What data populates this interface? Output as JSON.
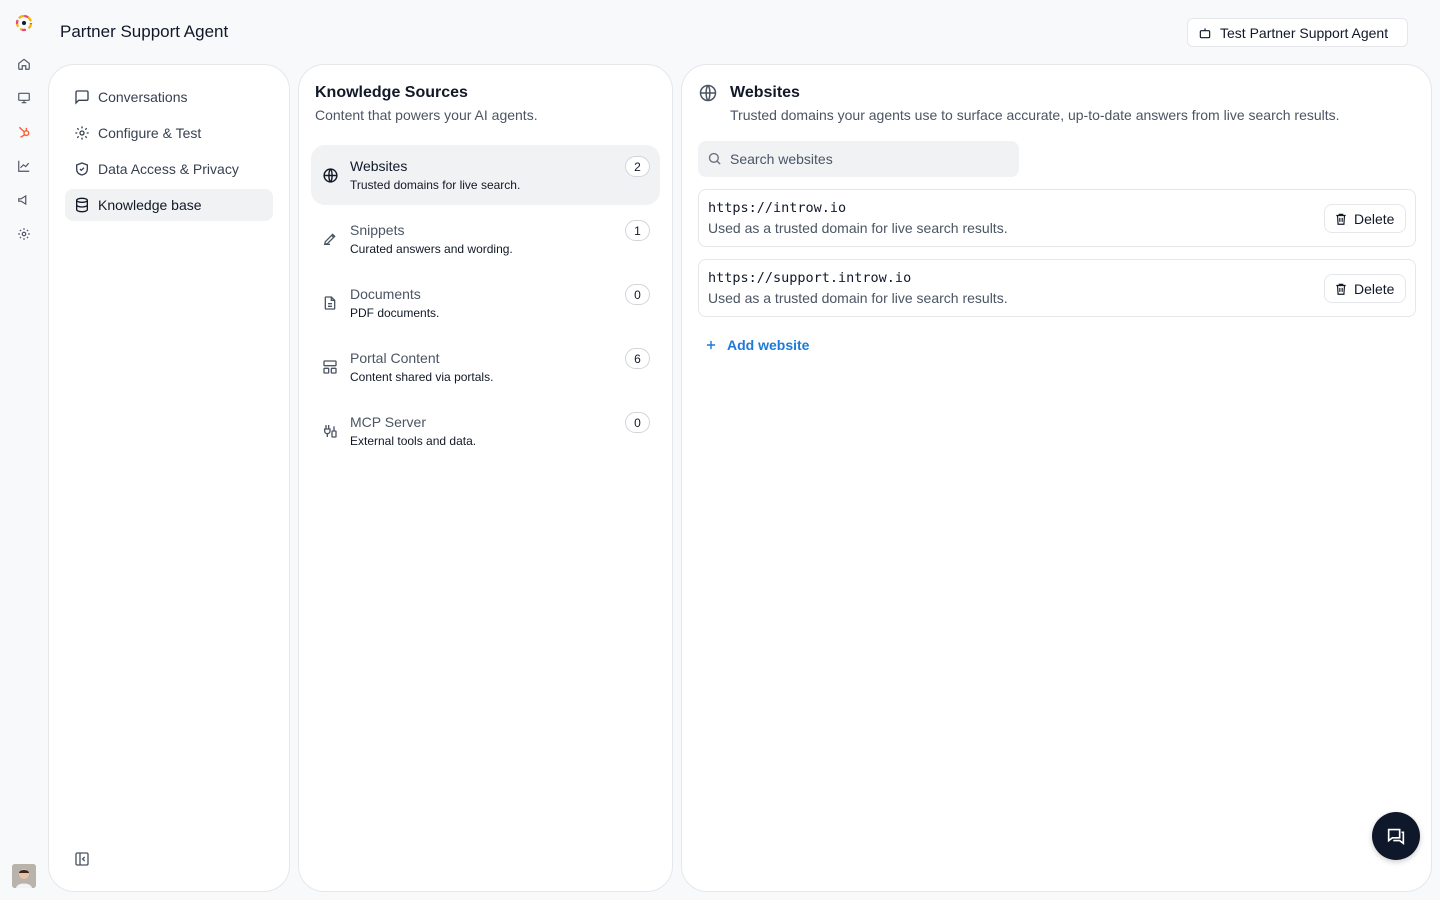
{
  "header": {
    "title": "Partner Support Agent",
    "test_button_label": "Test Partner Support Agent"
  },
  "rail": {
    "icons": [
      "logo-icon",
      "home-icon",
      "monitor-icon",
      "hubspot-icon",
      "chart-icon",
      "megaphone-icon",
      "gear-icon"
    ],
    "accent": "#ff5c35"
  },
  "nav": {
    "items": [
      {
        "label": "Conversations",
        "icon": "message-square-icon"
      },
      {
        "label": "Configure & Test",
        "icon": "gear-icon"
      },
      {
        "label": "Data Access & Privacy",
        "icon": "shield-check-icon"
      },
      {
        "label": "Knowledge base",
        "icon": "database-icon",
        "active": true
      }
    ]
  },
  "sources": {
    "title": "Knowledge Sources",
    "subtitle": "Content that powers your AI agents.",
    "items": [
      {
        "name": "Websites",
        "desc": "Trusted domains for live search.",
        "count": "2",
        "icon": "globe-icon",
        "active": true
      },
      {
        "name": "Snippets",
        "desc": "Curated answers and wording.",
        "count": "1",
        "icon": "pencil-icon"
      },
      {
        "name": "Documents",
        "desc": "PDF documents.",
        "count": "0",
        "icon": "file-text-icon"
      },
      {
        "name": "Portal Content",
        "desc": "Content shared via portals.",
        "count": "6",
        "icon": "layout-icon"
      },
      {
        "name": "MCP Server",
        "desc": "External tools and data.",
        "count": "0",
        "icon": "plug-icon"
      }
    ]
  },
  "main": {
    "title": "Websites",
    "subtitle": "Trusted domains your agents use to surface accurate, up-to-date answers from live search results.",
    "search_placeholder": "Search websites",
    "sites": [
      {
        "url": "https://introw.io",
        "note": "Used as a trusted domain for live search results.",
        "delete_label": "Delete"
      },
      {
        "url": "https://support.introw.io",
        "note": "Used as a trusted domain for live search results.",
        "delete_label": "Delete"
      }
    ],
    "add_label": "Add website",
    "accent": "#1d7ad6"
  }
}
